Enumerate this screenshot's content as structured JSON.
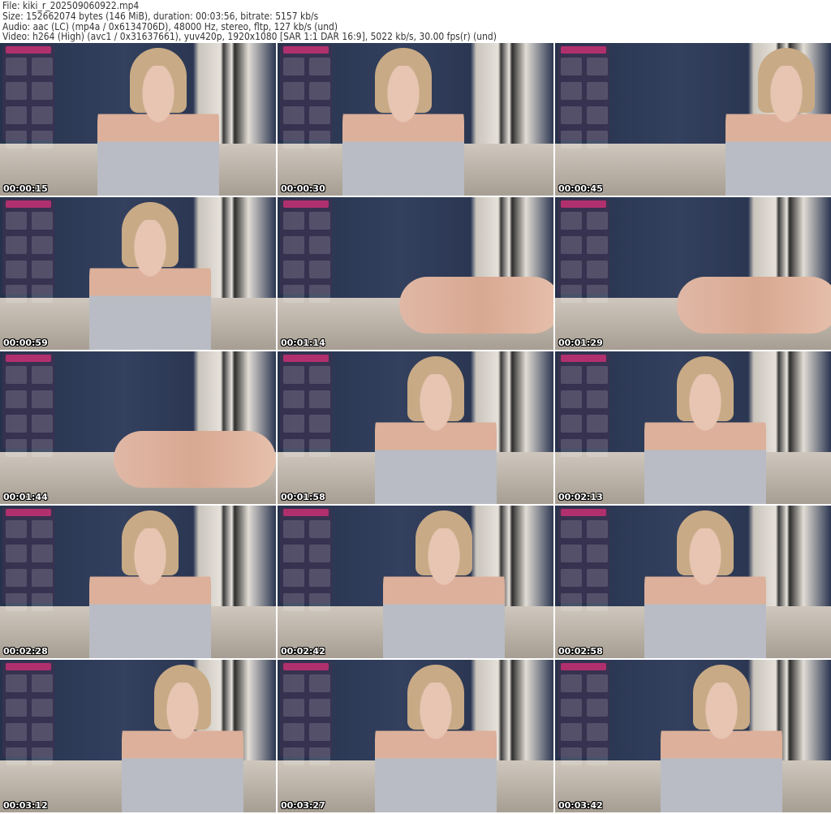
{
  "header": {
    "file": "File: kiki_r_202509060922.mp4",
    "size": "Size: 152662074 bytes (146 MiB), duration: 00:03:56, bitrate: 5157 kb/s",
    "audio": "Audio: aac (LC) (mp4a / 0x6134706D), 48000 Hz, stereo, fltp, 127 kb/s (und)",
    "video": "Video: h264 (High) (avc1 / 0x31637661), yuv420p, 1920x1080 [SAR 1:1 DAR 16:9], 5022 kb/s, 30.00 fps(r) (und)"
  },
  "thumbnails": [
    {
      "timestamp": "00:00:15",
      "pose": "a"
    },
    {
      "timestamp": "00:00:30",
      "pose": "a"
    },
    {
      "timestamp": "00:00:45",
      "pose": "a"
    },
    {
      "timestamp": "00:00:59",
      "pose": "a"
    },
    {
      "timestamp": "00:01:14",
      "pose": "b"
    },
    {
      "timestamp": "00:01:29",
      "pose": "b"
    },
    {
      "timestamp": "00:01:44",
      "pose": "b"
    },
    {
      "timestamp": "00:01:58",
      "pose": "a"
    },
    {
      "timestamp": "00:02:13",
      "pose": "a"
    },
    {
      "timestamp": "00:02:28",
      "pose": "a"
    },
    {
      "timestamp": "00:02:42",
      "pose": "a"
    },
    {
      "timestamp": "00:02:58",
      "pose": "a"
    },
    {
      "timestamp": "00:03:12",
      "pose": "a"
    },
    {
      "timestamp": "00:03:27",
      "pose": "a"
    },
    {
      "timestamp": "00:03:42",
      "pose": "a"
    }
  ]
}
